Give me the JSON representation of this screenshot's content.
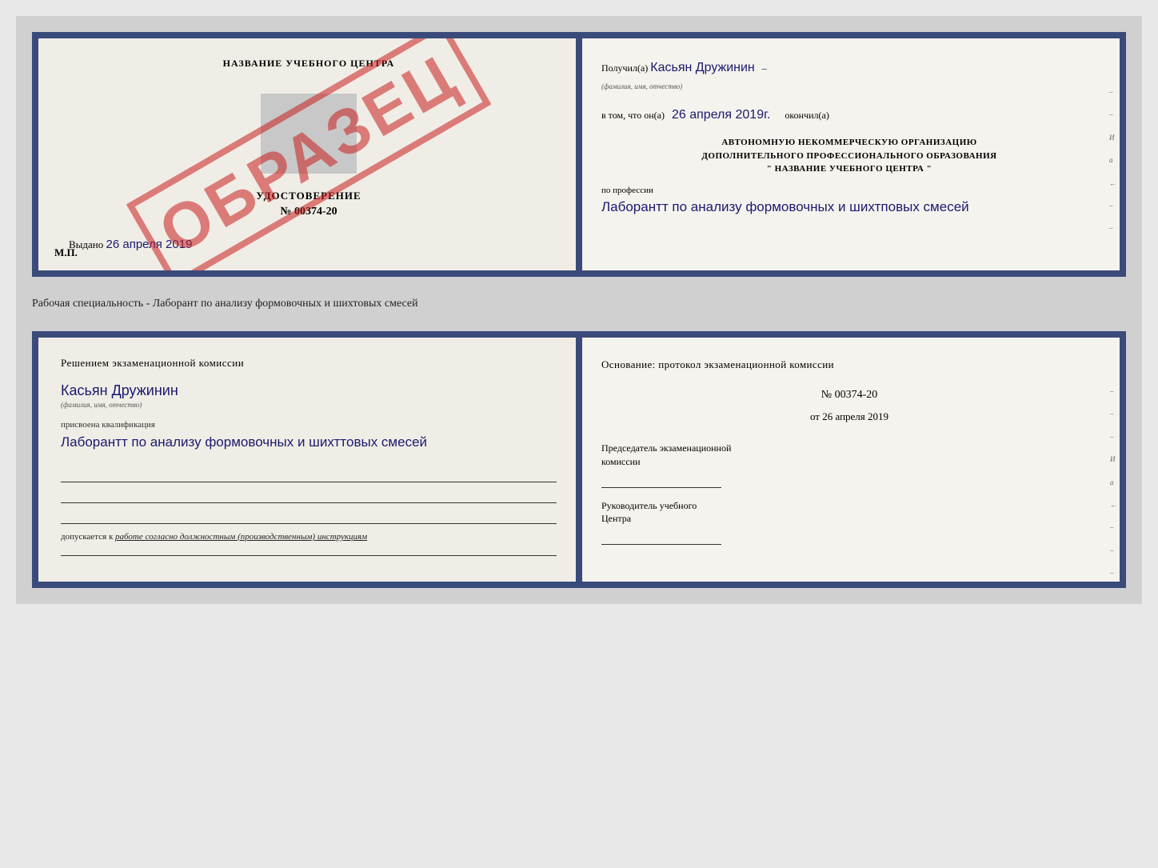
{
  "top_doc": {
    "left": {
      "title": "НАЗВАНИЕ УЧЕБНОГО ЦЕНТРА",
      "sample_stamp": "ОБРАЗЕЦ",
      "cert_label": "УДОСТОВЕРЕНИЕ",
      "cert_number": "№ 00374-20",
      "issued_text": "Выдано",
      "issued_date_handwritten": "26 апреля 2019",
      "mp_label": "М.П."
    },
    "right": {
      "received_prefix": "Получил(а)",
      "received_name_handwritten": "Касьян Дружинин",
      "fio_label": "(фамилия, имя, отчество)",
      "date_prefix": "в том, что он(а)",
      "date_handwritten": "26 апреля 2019г.",
      "finished_label": "окончил(а)",
      "org_line1": "АВТОНОМНУЮ НЕКОММЕРЧЕСКУЮ ОРГАНИЗАЦИЮ",
      "org_line2": "ДОПОЛНИТЕЛЬНОГО ПРОФЕССИОНАЛЬНОГО ОБРАЗОВАНИЯ",
      "org_line3": "\"   НАЗВАНИЕ УЧЕБНОГО ЦЕНТРА   \"",
      "profession_prefix": "по профессии",
      "profession_handwritten": "Лаборантт по анализу формовочных и шихтповых смесей",
      "side_marks": [
        "–",
        "–",
        "И",
        "а",
        "←",
        "–",
        "–"
      ]
    }
  },
  "separator": {
    "text": "Рабочая специальность - Лаборант по анализу формовочных и шихтовых смесей"
  },
  "bottom_doc": {
    "left": {
      "commission_title": "Решением  экзаменационной  комиссии",
      "name_handwritten": "Касьян Дружинин",
      "fio_label": "(фамилия, имя, отчество)",
      "qualification_prefix": "присвоена квалификация",
      "qualification_handwritten": "Лаборантт по анализу формовочных и шихттовых смесей",
      "allows_text": "допускается к",
      "allows_underline": "работе согласно должностным (производственным) инструкциям"
    },
    "right": {
      "basis_title": "Основание: протокол экзаменационной  комиссии",
      "protocol_number": "№  00374-20",
      "protocol_date_prefix": "от",
      "protocol_date": "26 апреля 2019",
      "chairman_label_line1": "Председатель экзаменационной",
      "chairman_label_line2": "комиссии",
      "director_label_line1": "Руководитель учебного",
      "director_label_line2": "Центра",
      "side_marks": [
        "–",
        "–",
        "–",
        "И",
        "а",
        "←",
        "–",
        "–",
        "–"
      ]
    }
  }
}
